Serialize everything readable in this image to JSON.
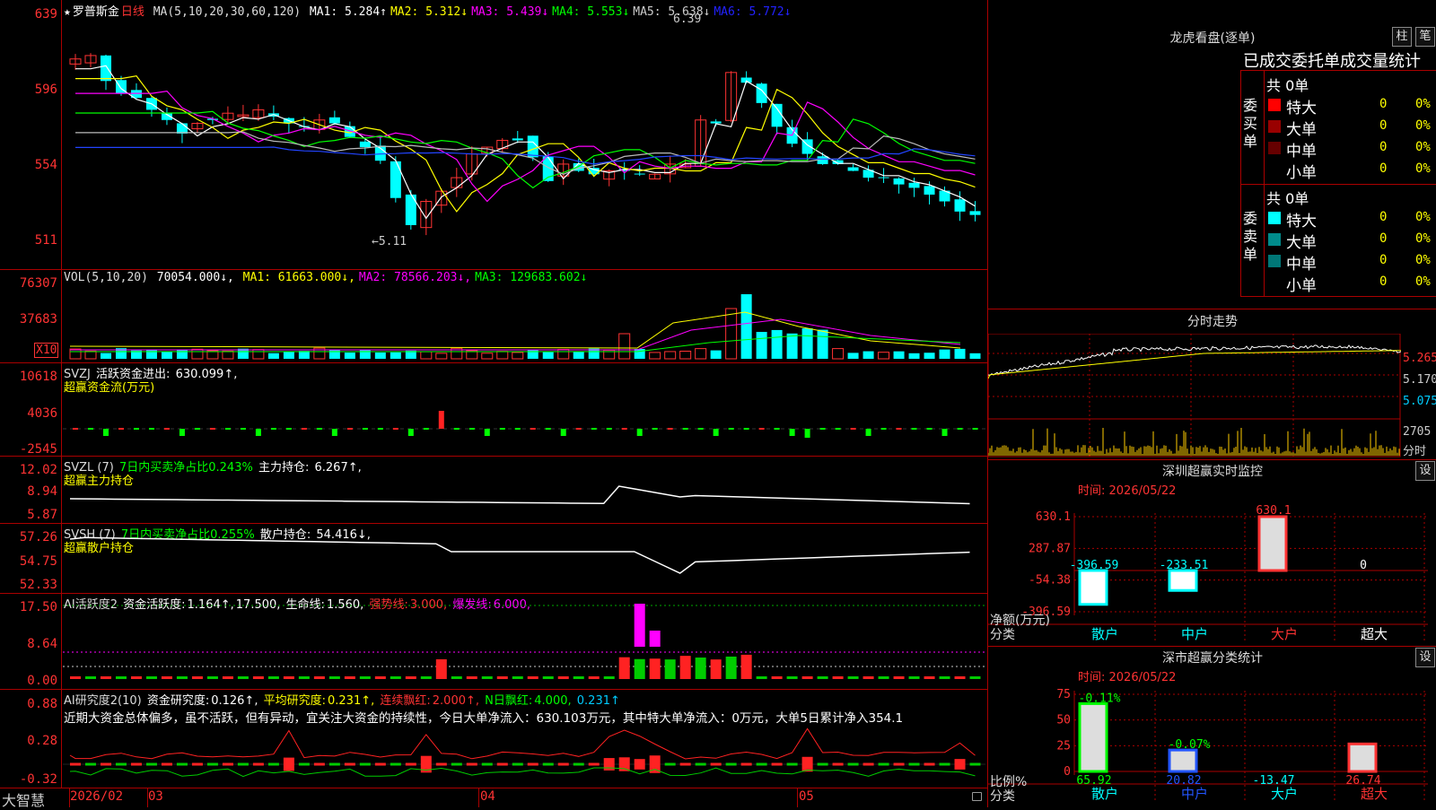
{
  "main": {
    "title_star": "★",
    "stock_name": "罗普斯金",
    "period": "日线",
    "ma_params": "MA(5,10,20,30,60,120)",
    "ma": [
      {
        "label": "MA1:",
        "value": "5.284↑",
        "color": "#ffffff"
      },
      {
        "label": "MA2:",
        "value": "5.312↓",
        "color": "#ffff00"
      },
      {
        "label": "MA3:",
        "value": "5.439↓",
        "color": "#ff00ff"
      },
      {
        "label": "MA4:",
        "value": "5.553↓",
        "color": "#00ff00"
      },
      {
        "label": "MA5:",
        "value": "5.638↓",
        "color": "#cccccc"
      },
      {
        "label": "MA6:",
        "value": "5.772↓",
        "color": "#2222ff"
      }
    ],
    "ylabels": [
      "639",
      "596",
      "554",
      "511"
    ],
    "high_mark": "6.39",
    "low_mark": "←5.11"
  },
  "vol": {
    "title": "VOL(5,10,20)",
    "value": "70054.000↓,",
    "ma": [
      {
        "label": "MA1:",
        "value": "61663.000↓,",
        "color": "#ffff00"
      },
      {
        "label": "MA2:",
        "value": "78566.203↓,",
        "color": "#ff00ff"
      },
      {
        "label": "MA3:",
        "value": "129683.602↓",
        "color": "#00ff00"
      }
    ],
    "ylabels": [
      "76307",
      "37683"
    ],
    "unit": "X10"
  },
  "svzj": {
    "title": "SVZJ",
    "label": "活跃资金进出:",
    "value": "630.099↑,",
    "sub": "超赢资金流(万元)",
    "ylabels": [
      "10618",
      "4036",
      "-2545"
    ]
  },
  "svzl": {
    "title": "SVZL (7)",
    "t1": "7日内买卖净占比0.243%",
    "t2": "主力持仓:",
    "t2v": "6.267↑,",
    "sub": "超赢主力持仓",
    "ylabels": [
      "12.02",
      "8.94",
      "5.87"
    ]
  },
  "svsh": {
    "title": "SVSH (7)",
    "t1": "7日内买卖净占比0.255%",
    "t2": "散户持仓:",
    "t2v": "54.416↓,",
    "sub": "超赢散户持仓",
    "ylabels": [
      "57.26",
      "54.75",
      "52.33"
    ]
  },
  "aihy": {
    "title": "AI活跃度2",
    "t1": "资金活跃度:",
    "t1v": "1.164↑,",
    "t1v2": "17.500,",
    "t2": "生命线:",
    "t2v": "1.560,",
    "t3": "强势线:",
    "t3v": "3.000,",
    "t4": "爆发线:",
    "t4v": "6.000,",
    "ylabels": [
      "17.50",
      "8.64",
      "0.00"
    ]
  },
  "aiyj": {
    "title": "AI研究度2(10)",
    "t1": "资金研究度:",
    "t1v": "0.126↑,",
    "t2": "平均研究度:",
    "t2v": "0.231↑,",
    "t3": "连续飘红:",
    "t3v": "2.000↑,",
    "t4": "N日飘红:",
    "t4v": "4.000,",
    "t4v2": "0.231↑",
    "comment": "近期大资金总体偏多，虽不活跃，但有异动，宜关注大资金的持续性，今日大单净流入：630.103万元，其中特大单净流入：0万元，大单5日累计净入354.1",
    "ylabels": [
      "0.88",
      "0.28",
      "-0.32"
    ]
  },
  "xaxis": {
    "brand": "大智慧",
    "labels": [
      "2026/02",
      "03",
      "04",
      "05"
    ]
  },
  "right": {
    "lhb": {
      "title": "龙虎看盘(逐单)",
      "btn1": "柱",
      "btn2": "笔",
      "tabs": "已成交委托单成交量统计",
      "buy": {
        "side": "委买单",
        "total": "共 0单",
        "rows": [
          {
            "name": "特大",
            "count": "0",
            "pct": "0%",
            "color": "#ff0000"
          },
          {
            "name": "大单",
            "count": "0",
            "pct": "0%",
            "color": "#990000"
          },
          {
            "name": "中单",
            "count": "0",
            "pct": "0%",
            "color": "#660000"
          },
          {
            "name": "小单",
            "count": "0",
            "pct": "0%",
            "color": ""
          }
        ]
      },
      "sell": {
        "side": "委卖单",
        "total": "共 0单",
        "rows": [
          {
            "name": "特大",
            "count": "0",
            "pct": "0%",
            "color": "#00ffff"
          },
          {
            "name": "大单",
            "count": "0",
            "pct": "0%",
            "color": "#008b8b"
          },
          {
            "name": "中单",
            "count": "0",
            "pct": "0%",
            "color": "#007777"
          },
          {
            "name": "小单",
            "count": "0",
            "pct": "0%",
            "color": ""
          }
        ]
      }
    },
    "intraday": {
      "title": "分时走势",
      "ylabels": [
        "5.265",
        "5.170",
        "5.075"
      ],
      "vol_label": "2705",
      "unit": "分时"
    },
    "monitor": {
      "title": "深圳超赢实时监控",
      "btn": "设",
      "time": "时间: 2026/05/22",
      "ylabels": [
        "630.1",
        "287.87",
        "-54.38",
        "-396.59"
      ],
      "side_label": "净额(万元)",
      "side_label2": "分类",
      "cats": [
        "散户",
        "中户",
        "大户",
        "超大"
      ],
      "cat_colors": [
        "#00ffff",
        "#00ffff",
        "#ff3333",
        "#ffffff"
      ],
      "bar_labels": [
        "-396.59",
        "-233.51",
        "630.1",
        "0"
      ],
      "bar_values": [
        -396.59,
        -233.51,
        630.1,
        0
      ]
    },
    "stats": {
      "title": "深市超赢分类统计",
      "btn": "设",
      "time": "时间: 2026/05/22",
      "ylabels": [
        "75",
        "50",
        "25",
        "0"
      ],
      "side_label": "比例%",
      "side_label2": "分类",
      "cats": [
        "散户",
        "中户",
        "大户",
        "超大"
      ],
      "top_labels": [
        "-0.11%",
        "-0.07%",
        "",
        ""
      ],
      "values": [
        "65.92",
        "20.82",
        "-13.47",
        "26.74"
      ],
      "value_colors": [
        "#00ff00",
        "#2255ff",
        "#00ffff",
        "#ff3333"
      ],
      "bar_values": [
        65.92,
        20.82,
        0,
        26.74
      ]
    }
  }
}
